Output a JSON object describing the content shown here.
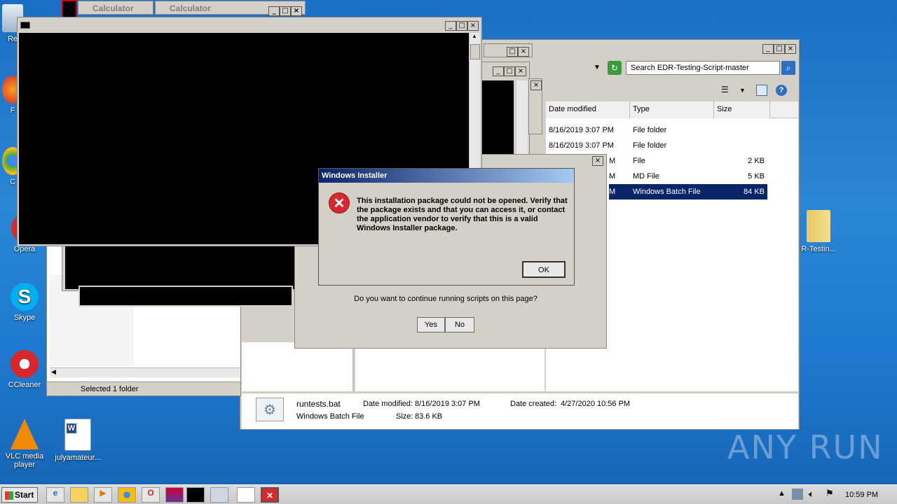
{
  "desktop": {
    "icons": [
      {
        "label": "Re",
        "name": "recycle-bin"
      },
      {
        "label": "F",
        "name": "firefox"
      },
      {
        "label": "C",
        "name": "chrome"
      },
      {
        "label": "Opera",
        "name": "opera"
      },
      {
        "label": "Skype",
        "name": "skype"
      },
      {
        "label": "CCleaner",
        "name": "ccleaner"
      },
      {
        "label": "VLC media player",
        "name": "vlc"
      },
      {
        "label": "julyamateur...",
        "name": "word-doc"
      },
      {
        "label": "R-Testin...",
        "name": "folder"
      }
    ],
    "watermark": "ANY RUN"
  },
  "calculator_tabs": [
    "Calculator",
    "Calculator"
  ],
  "explorer": {
    "search_placeholder": "Search EDR-Testing-Script-master",
    "columns": [
      "Date modified",
      "Type",
      "Size"
    ],
    "rows": [
      {
        "date": "8/16/2019 3:07 PM",
        "type": "File folder",
        "size": ""
      },
      {
        "date": "8/16/2019 3:07 PM",
        "type": "File folder",
        "size": ""
      },
      {
        "date": "M",
        "type": "File",
        "size": "2 KB"
      },
      {
        "date": "M",
        "type": "MD File",
        "size": "5 KB"
      },
      {
        "date": "M",
        "type": "Windows Batch File",
        "size": "84 KB"
      }
    ],
    "details": {
      "filename": "runtests.bat",
      "filetype": "Windows Batch File",
      "modified_label": "Date modified:",
      "modified_value": "8/16/2019 3:07 PM",
      "created_label": "Date created:",
      "created_value": "4/27/2020 10:56 PM",
      "size_label": "Size:",
      "size_value": "83.6 KB"
    },
    "status": "Selected 1 folder"
  },
  "script_dialog": {
    "question": "Do you want to continue running scripts on this page?",
    "yes": "Yes",
    "no": "No"
  },
  "installer_dialog": {
    "title": "Windows Installer",
    "message": "This installation package could not be opened. Verify that the package exists and that you can access it, or contact the application vendor to verify that this is a valid Windows Installer package.",
    "ok": "OK"
  },
  "taskbar": {
    "start": "Start",
    "clock": "10:59 PM"
  },
  "colors": {
    "selection": "#0a246a",
    "error_red": "#d9272e"
  }
}
